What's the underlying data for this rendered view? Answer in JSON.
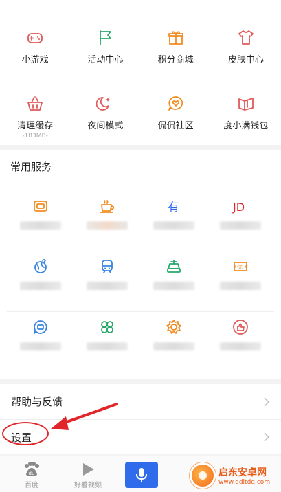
{
  "tools": [
    {
      "label": "小游戏",
      "icon": "gamepad-icon",
      "color": "#e05a5a"
    },
    {
      "label": "活动中心",
      "icon": "flag-icon",
      "color": "#2aa86a"
    },
    {
      "label": "积分商城",
      "icon": "gift-icon",
      "color": "#f08c22"
    },
    {
      "label": "皮肤中心",
      "icon": "tshirt-icon",
      "color": "#e05a5a"
    },
    {
      "label": "清理缓存",
      "sub": "-183MB-",
      "icon": "basket-icon",
      "color": "#e05a5a"
    },
    {
      "label": "夜间模式",
      "icon": "moon-icon",
      "color": "#e05a5a"
    },
    {
      "label": "侃侃社区",
      "icon": "chat-heart-icon",
      "color": "#f08c22"
    },
    {
      "label": "度小满钱包",
      "icon": "wallet-icon",
      "color": "#e05a5a"
    }
  ],
  "services": {
    "title": "常用服务",
    "items": [
      {
        "icon": "card-icon",
        "color": "#f08c22",
        "glyph": ""
      },
      {
        "icon": "coffee-icon",
        "color": "#f08c22",
        "glyph": ""
      },
      {
        "icon": "youdao-icon",
        "color": "#2f6bea",
        "glyph": "有"
      },
      {
        "icon": "jd-icon",
        "color": "#e0262a",
        "glyph": "JD"
      },
      {
        "icon": "globe-icon",
        "color": "#3a85e0",
        "glyph": ""
      },
      {
        "icon": "train-icon",
        "color": "#3a85e0",
        "glyph": ""
      },
      {
        "icon": "car-icon",
        "color": "#2aa86a",
        "glyph": ""
      },
      {
        "icon": "coupon-icon",
        "color": "#f08c22",
        "glyph": ""
      },
      {
        "icon": "ticket-chat-icon",
        "color": "#3a85e0",
        "glyph": ""
      },
      {
        "icon": "clover-icon",
        "color": "#2aa86a",
        "glyph": ""
      },
      {
        "icon": "lion-icon",
        "color": "#f08c22",
        "glyph": ""
      },
      {
        "icon": "thumbs-up-icon",
        "color": "#e05a5a",
        "glyph": ""
      }
    ]
  },
  "menu": {
    "help_label": "帮助与反馈",
    "settings_label": "设置"
  },
  "tabbar": {
    "home_label": "百度",
    "video_label": "好看视频"
  },
  "watermark": {
    "name": "启东安卓网",
    "url": "www.qdltdq.com"
  },
  "colors": {
    "accent_blue": "#2f6bea",
    "annotation_red": "#e0262a"
  }
}
